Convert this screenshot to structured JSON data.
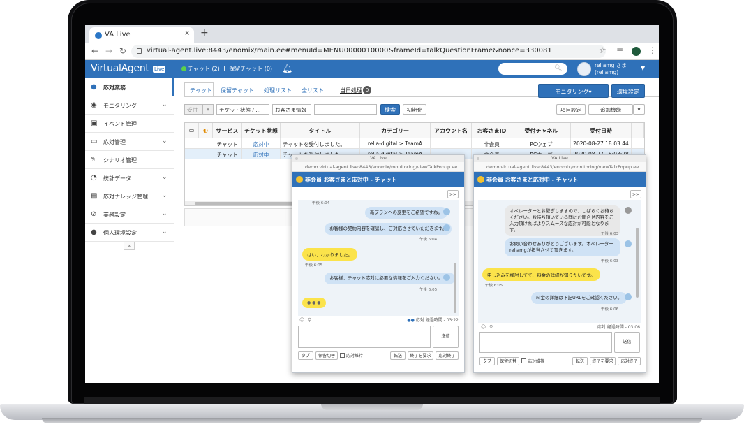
{
  "browser": {
    "tab_title": "VA Live",
    "tab_close": "×",
    "new_tab": "+",
    "url": "virtual-agent.live:8443/enomix/main.ee#menuId=MENU0000010000&frameId=talkQuestionFrame&nonce=330081"
  },
  "header": {
    "logo": "VirtualAgent",
    "logo_badge": "Live",
    "chat_status": "チャット (2)",
    "separator": "I",
    "hold_status": "保留チャット (0)",
    "user_name": "reliamg さま",
    "user_id": "(reliamg)"
  },
  "sidebar": {
    "items": [
      {
        "label": "応対業務"
      },
      {
        "label": "モニタリング"
      },
      {
        "label": "イベント管理"
      },
      {
        "label": "応対管理"
      },
      {
        "label": "シナリオ管理"
      },
      {
        "label": "統計データ"
      },
      {
        "label": "応対ナレッジ管理"
      },
      {
        "label": "業務設定"
      },
      {
        "label": "個人環境設定"
      }
    ],
    "collapse": "«"
  },
  "main": {
    "tabs": [
      "チャット",
      "保留チャット",
      "処理リスト",
      "全リスト",
      "当日処理"
    ],
    "today_count": "0",
    "monitoring_button": "モニタリング▾",
    "env_button": "環境設定",
    "filter": {
      "status_select": "受付",
      "chat_status_select": "チケット状態 / ...",
      "customer_info_select": "お客さま情報",
      "search_button": "検索",
      "reset_button": "初期化",
      "columns_button": "項目設定",
      "add_function_button": "追加機能"
    },
    "table": {
      "headers": [
        "サービス",
        "チケット状態",
        "タイトル",
        "カテゴリー",
        "アカウント名",
        "お客さまID",
        "受付チャネル",
        "受付日時"
      ],
      "rows": [
        [
          "チャット",
          "応対中",
          "チャットを受付しました。",
          "relia-digital > TeamA",
          "",
          "非会員",
          "PCウェブ",
          "2020-08-27 18:03:44"
        ],
        [
          "チャット",
          "応対中",
          "チャットを受付しました。",
          "relia-digital > TeamA",
          "",
          "非会員",
          "PCウェブ",
          "2020-08-27 18:03:28"
        ]
      ]
    }
  },
  "popups": [
    {
      "window_title": "VA Live",
      "url": "demo.virtual-agent.live:8443/enomix/monitoring/viewTalkPopup.ee",
      "header": "非会員 お客さまと応対中 - チャット",
      "expand": ">>",
      "messages": [
        {
          "type": "time",
          "text": "午後 6:04"
        },
        {
          "type": "op",
          "text": "新プランへの変更をご希望ですね。"
        },
        {
          "type": "op",
          "text": "お客様の契約内容を確認し、ご対応させていただきます。"
        },
        {
          "type": "time",
          "text": "午後 6:04"
        },
        {
          "type": "cu",
          "text": "はい、わかりました。"
        },
        {
          "type": "time",
          "text": "午後 6:05"
        },
        {
          "type": "op",
          "text": "お客様、チャット応対に必要な情報をご入力ください。^^"
        },
        {
          "type": "time",
          "text": "午後 6:05"
        },
        {
          "type": "cu",
          "text": "● ● ●"
        }
      ],
      "elapsed": "応対 経過時間 - 03:22",
      "send": "送信",
      "buttons": [
        "タブ",
        "保留切替",
        "応対維持",
        "転送",
        "終了を要求",
        "応対終了"
      ]
    },
    {
      "window_title": "VA Live",
      "url": "demo.virtual-agent.live:8443/enomix/monitoring/viewTalkPopup.ee",
      "header": "非会員 お客さまと応対中 - チャット",
      "expand": ">>",
      "messages": [
        {
          "type": "sys",
          "text": "オペレーターとお繋ぎしますので、しばらくお待ちください。お待ち頂いている間にお問合せ内容をご入力頂ければよりスムーズな応対が可能となります。"
        },
        {
          "type": "time",
          "text": "午後 6:03"
        },
        {
          "type": "op",
          "text": "お問い合わせありがとうございます。オペレーターreliamgが担当させて頂きます。"
        },
        {
          "type": "time",
          "text": "午後 6:03"
        },
        {
          "type": "cu",
          "text": "申し込みを検討してて、料金の詳細が知りたいです。"
        },
        {
          "type": "time",
          "text": "午後 6:05"
        },
        {
          "type": "op",
          "text": "料金の詳細は下記URLをご確認ください。"
        },
        {
          "type": "time",
          "text": "午後 6:06"
        }
      ],
      "elapsed": "応対 経過時間 - 03:06",
      "send": "送信",
      "buttons": [
        "タブ",
        "保留切替",
        "応対維持",
        "転送",
        "終了を要求",
        "応対終了"
      ]
    }
  ]
}
